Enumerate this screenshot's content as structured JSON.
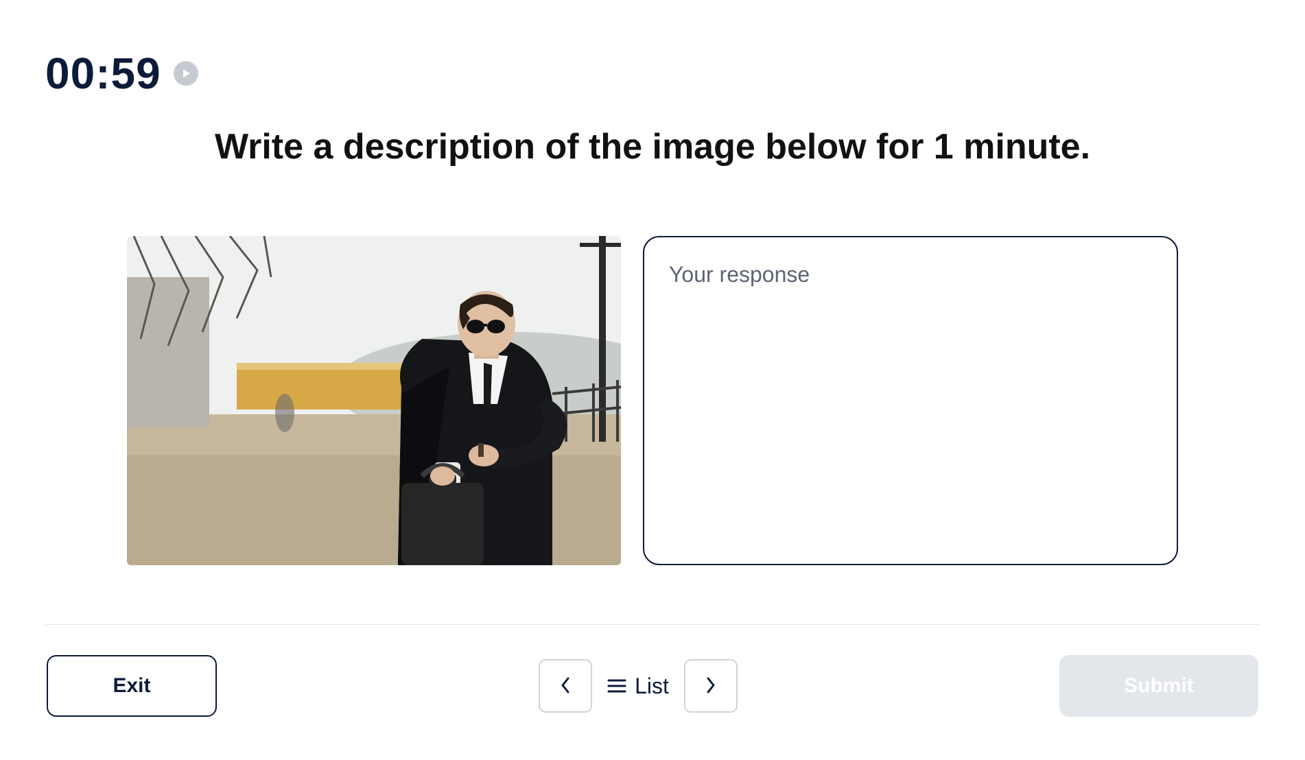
{
  "timer": {
    "display": "00:59"
  },
  "prompt": "Write a description of the image below for 1 minute.",
  "response": {
    "placeholder": "Your response",
    "value": ""
  },
  "footer": {
    "exit_label": "Exit",
    "list_label": "List",
    "submit_label": "Submit"
  },
  "icons": {
    "play": "play-icon",
    "prev": "chevron-left-icon",
    "next": "chevron-right-icon",
    "list": "menu-icon"
  },
  "image_description": "businessman-checking-watch"
}
